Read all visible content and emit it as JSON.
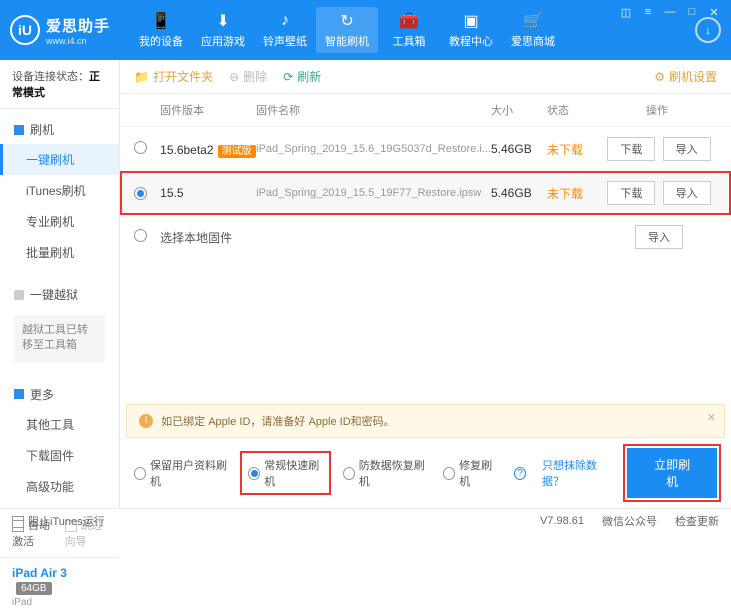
{
  "brand": {
    "name": "爱思助手",
    "url": "www.i4.cn",
    "logo": "iU"
  },
  "nav": {
    "items": [
      {
        "label": "我的设备",
        "icon": "📱"
      },
      {
        "label": "应用游戏",
        "icon": "⬇"
      },
      {
        "label": "铃声壁纸",
        "icon": "♪"
      },
      {
        "label": "智能刷机",
        "icon": "↻"
      },
      {
        "label": "工具箱",
        "icon": "🧰"
      },
      {
        "label": "教程中心",
        "icon": "▣"
      },
      {
        "label": "爱思商城",
        "icon": "🛒"
      }
    ]
  },
  "sidebar": {
    "conn_label": "设备连接状态：",
    "conn_value": "正常模式",
    "flash_head": "刷机",
    "flash_items": [
      "一键刷机",
      "iTunes刷机",
      "专业刷机",
      "批量刷机"
    ],
    "jailbreak_head": "一键越狱",
    "jailbreak_note": "越狱工具已转移至工具箱",
    "more_head": "更多",
    "more_items": [
      "其他工具",
      "下载固件",
      "高级功能"
    ],
    "auto_activate": "自动激活",
    "skip_guide": "跳过向导",
    "device_name": "iPad Air 3",
    "device_storage": "64GB",
    "device_type": "iPad"
  },
  "toolbar": {
    "open_folder": "打开文件夹",
    "delete": "删除",
    "refresh": "刷新",
    "flash_settings": "刷机设置"
  },
  "table": {
    "headers": {
      "version": "固件版本",
      "name": "固件名称",
      "size": "大小",
      "state": "状态",
      "ops": "操作"
    },
    "rows": [
      {
        "version": "15.6beta2",
        "beta": "测试版",
        "name": "iPad_Spring_2019_15.6_19G5037d_Restore.i...",
        "size": "5.46GB",
        "state": "未下载",
        "download": "下载",
        "import": "导入",
        "checked": false
      },
      {
        "version": "15.5",
        "beta": "",
        "name": "iPad_Spring_2019_15.5_19F77_Restore.ipsw",
        "size": "5.46GB",
        "state": "未下载",
        "download": "下载",
        "import": "导入",
        "checked": true
      }
    ],
    "local_row": {
      "label": "选择本地固件",
      "import": "导入"
    }
  },
  "warning": {
    "text": "如已绑定 Apple ID，请准备好 Apple ID和密码。"
  },
  "options": {
    "keep_data": "保留用户资料刷机",
    "normal_fast": "常规快速刷机",
    "anti_recovery": "防数据恢复刷机",
    "repair": "修复刷机",
    "exclude_link": "只想抹除数据？",
    "flash_now": "立即刷机"
  },
  "statusbar": {
    "block_itunes": "阻止iTunes运行",
    "version": "V7.98.61",
    "wechat": "微信公众号",
    "check_update": "检查更新"
  }
}
